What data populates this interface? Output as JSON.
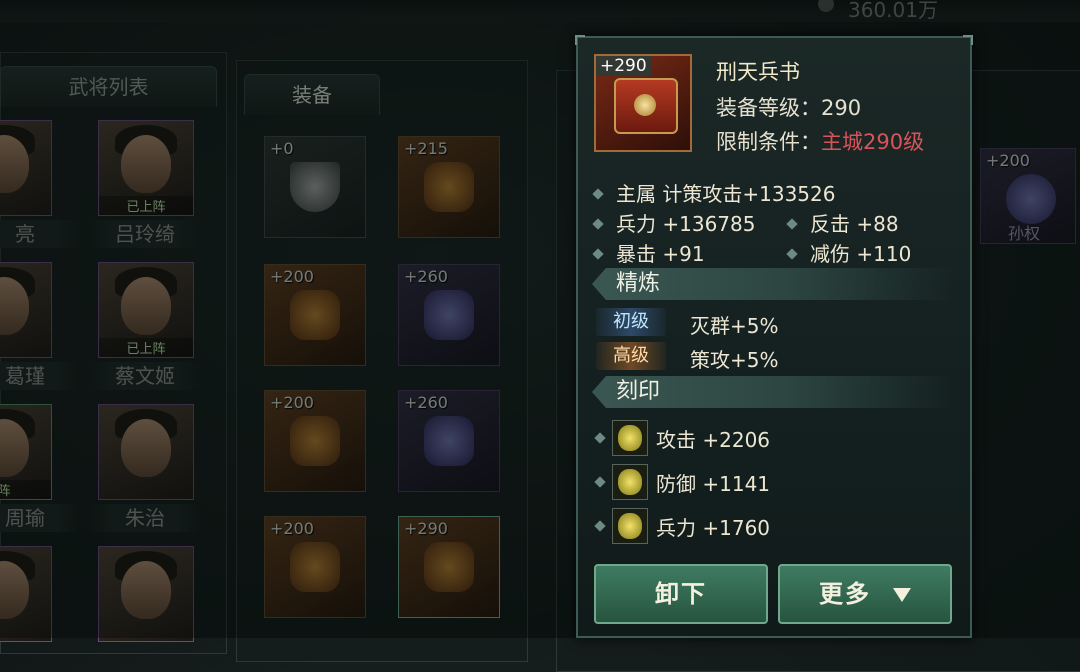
{
  "top": {
    "currency": "360.01万"
  },
  "tabs": {
    "generals": "武将列表",
    "equipment": "装备"
  },
  "heroes": [
    {
      "name": "亮",
      "deployed": ""
    },
    {
      "name": "吕玲绮",
      "deployed": "已上阵"
    },
    {
      "name": "葛瑾",
      "deployed": ""
    },
    {
      "name": "蔡文姬",
      "deployed": "已上阵"
    },
    {
      "name": "周瑜",
      "deployed": "阵"
    },
    {
      "name": "朱治",
      "deployed": ""
    }
  ],
  "equip_items": [
    {
      "level": "+0"
    },
    {
      "level": "+215"
    },
    {
      "level": "+200"
    },
    {
      "level": "+260"
    },
    {
      "level": "+200"
    },
    {
      "level": "+260"
    },
    {
      "level": "+200"
    },
    {
      "level": "+290"
    }
  ],
  "right_item": {
    "level": "+200",
    "name": "孙权"
  },
  "tooltip": {
    "badge": "+290",
    "name": "刑天兵书",
    "equip_level_label": "装备等级：",
    "equip_level_value": "290",
    "limit_label": "限制条件：",
    "limit_value": "主城290级",
    "main_stat": "主属  计策攻击+133526",
    "stats": [
      {
        "text": "兵力  +136785"
      },
      {
        "text": "反击  +88"
      },
      {
        "text": "暴击  +91"
      },
      {
        "text": "减伤  +110"
      }
    ],
    "refine_title": "精炼",
    "refines": [
      {
        "tag": "初级",
        "text": "灭群+5%"
      },
      {
        "tag": "高级",
        "text": "策攻+5%"
      }
    ],
    "engrave_title": "刻印",
    "engraves": [
      {
        "text": "攻击  +2206"
      },
      {
        "text": "防御  +1141"
      },
      {
        "text": "兵力  +1760"
      }
    ],
    "unequip_label": "卸下",
    "more_label": "更多"
  }
}
